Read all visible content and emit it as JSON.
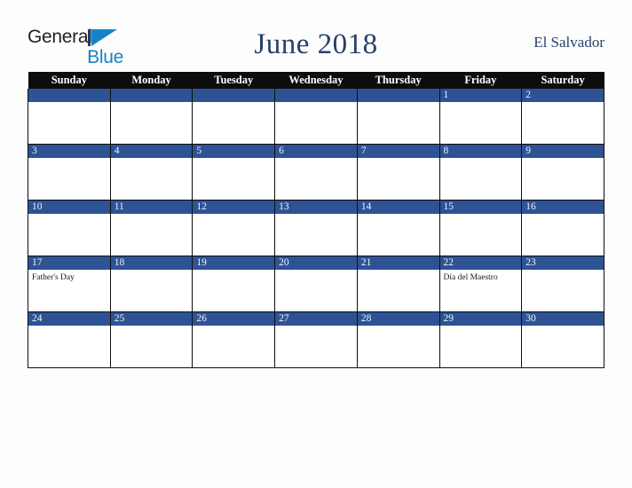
{
  "branding": {
    "name_part1": "General",
    "name_part2": "Blue",
    "logo_icon": "triangle-flag-icon"
  },
  "header": {
    "title": "June 2018",
    "region": "El Salvador"
  },
  "calendar": {
    "weekday_headers": [
      "Sunday",
      "Monday",
      "Tuesday",
      "Wednesday",
      "Thursday",
      "Friday",
      "Saturday"
    ],
    "accent_color": "#2e5395",
    "header_color": "#0d0d0d",
    "title_color": "#27406b",
    "weeks": [
      [
        {
          "day": "",
          "event": ""
        },
        {
          "day": "",
          "event": ""
        },
        {
          "day": "",
          "event": ""
        },
        {
          "day": "",
          "event": ""
        },
        {
          "day": "",
          "event": ""
        },
        {
          "day": "1",
          "event": ""
        },
        {
          "day": "2",
          "event": ""
        }
      ],
      [
        {
          "day": "3",
          "event": ""
        },
        {
          "day": "4",
          "event": ""
        },
        {
          "day": "5",
          "event": ""
        },
        {
          "day": "6",
          "event": ""
        },
        {
          "day": "7",
          "event": ""
        },
        {
          "day": "8",
          "event": ""
        },
        {
          "day": "9",
          "event": ""
        }
      ],
      [
        {
          "day": "10",
          "event": ""
        },
        {
          "day": "11",
          "event": ""
        },
        {
          "day": "12",
          "event": ""
        },
        {
          "day": "13",
          "event": ""
        },
        {
          "day": "14",
          "event": ""
        },
        {
          "day": "15",
          "event": ""
        },
        {
          "day": "16",
          "event": ""
        }
      ],
      [
        {
          "day": "17",
          "event": "Father's Day"
        },
        {
          "day": "18",
          "event": ""
        },
        {
          "day": "19",
          "event": ""
        },
        {
          "day": "20",
          "event": ""
        },
        {
          "day": "21",
          "event": ""
        },
        {
          "day": "22",
          "event": "Día del Maestro"
        },
        {
          "day": "23",
          "event": ""
        }
      ],
      [
        {
          "day": "24",
          "event": ""
        },
        {
          "day": "25",
          "event": ""
        },
        {
          "day": "26",
          "event": ""
        },
        {
          "day": "27",
          "event": ""
        },
        {
          "day": "28",
          "event": ""
        },
        {
          "day": "29",
          "event": ""
        },
        {
          "day": "30",
          "event": ""
        }
      ]
    ]
  }
}
